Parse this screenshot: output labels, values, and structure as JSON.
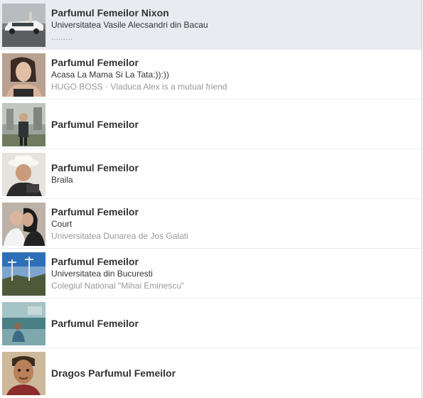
{
  "results": [
    {
      "name": "Parfumul Femeilor Nixon",
      "line1": "Universitatea Vasile Alecsandri din Bacau",
      "line2": ".........",
      "thumb_icon": "profile-photo-car"
    },
    {
      "name": "Parfumul Femeilor",
      "line1": "Acasa La Mama Si La Tata:)):))",
      "line2": "HUGO BOSS · Vladuca Alex is a mutual friend",
      "thumb_icon": "profile-photo-woman"
    },
    {
      "name": "Parfumul Femeilor",
      "thumb_icon": "profile-photo-street"
    },
    {
      "name": "Parfumul Femeilor",
      "line1": "Braila",
      "thumb_icon": "profile-photo-hat"
    },
    {
      "name": "Parfumul Femeilor",
      "line1": "Court",
      "line2": "Universitatea Dunarea de Jos Galati",
      "thumb_icon": "profile-photo-couple"
    },
    {
      "name": "Parfumul Femeilor",
      "line1": "Universitatea din Bucuresti",
      "line2": "Colegiul National \"Mihai Eminescu\"",
      "thumb_icon": "profile-photo-landscape"
    },
    {
      "name": "Parfumul Femeilor",
      "thumb_icon": "profile-photo-water"
    },
    {
      "name": "Dragos Parfumul Femeilor",
      "thumb_icon": "profile-photo-face"
    }
  ],
  "colors": {
    "selected_row": "#e9ebf1",
    "name_text": "#333333",
    "secondary_text": "#999999",
    "divider": "#e9eaed"
  }
}
